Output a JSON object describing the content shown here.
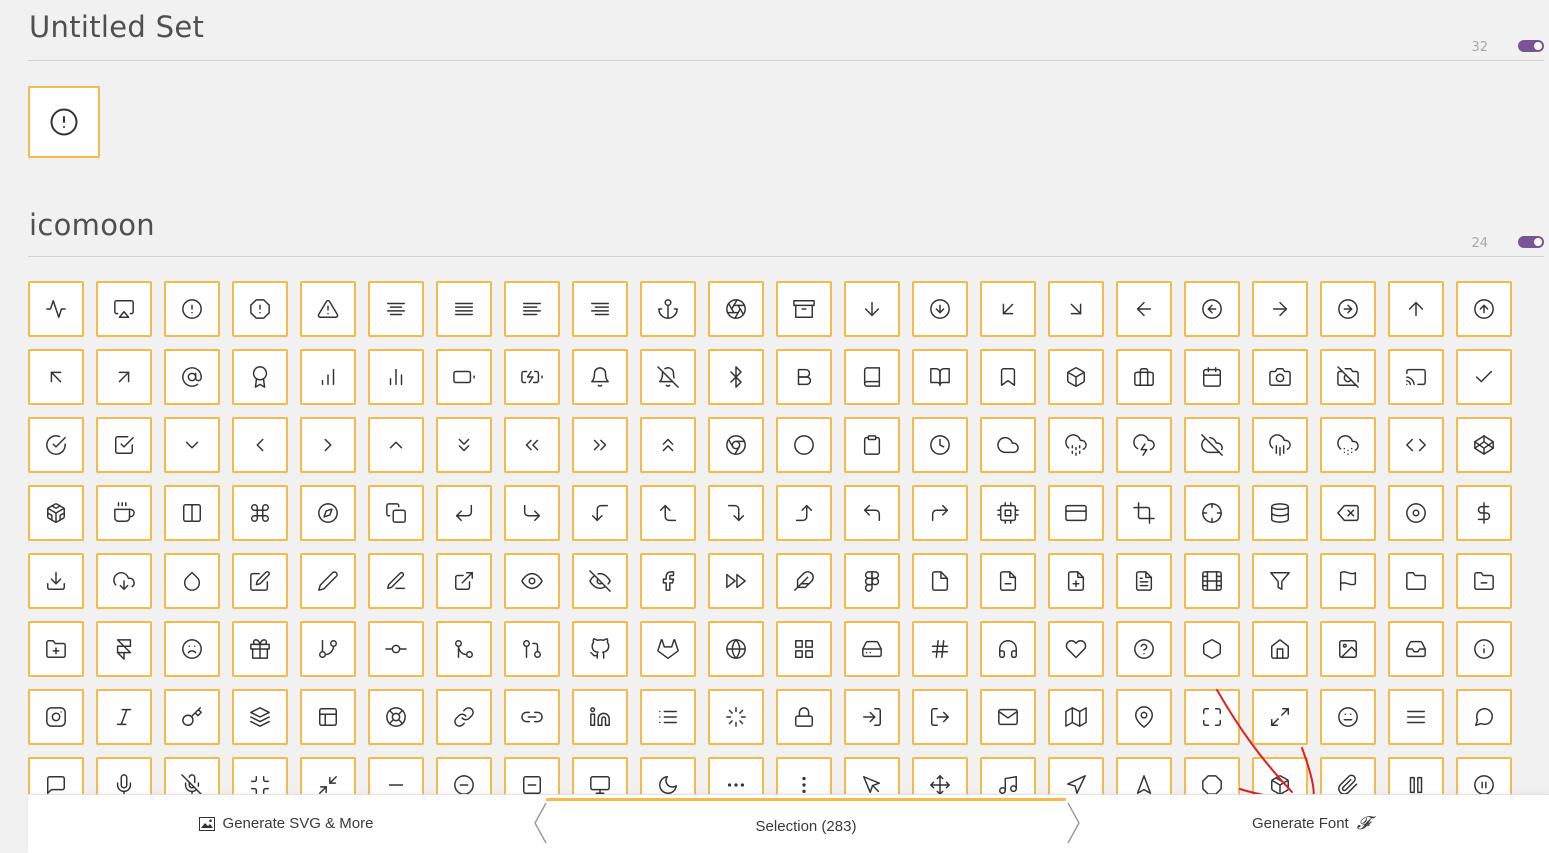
{
  "sets": [
    {
      "title": "Untitled Set",
      "count": "32",
      "enabled": true
    },
    {
      "title": "icomoon",
      "count": "24",
      "enabled": true
    }
  ],
  "untitled_icons": [
    "alert-circle"
  ],
  "icomoon_icons": [
    "activity",
    "airplay",
    "alert-circle",
    "alert-octagon",
    "alert-triangle",
    "align-center",
    "align-justify",
    "align-left",
    "align-right",
    "anchor",
    "aperture",
    "archive",
    "arrow-down",
    "arrow-down-circle",
    "arrow-down-left",
    "arrow-down-right",
    "arrow-left",
    "arrow-left-circle",
    "arrow-right",
    "arrow-right-circle",
    "arrow-up",
    "arrow-up-circle",
    "arrow-up-left",
    "arrow-up-right",
    "at-sign",
    "award",
    "bar-chart",
    "bar-chart-2",
    "battery",
    "battery-charging",
    "bell",
    "bell-off",
    "bluetooth",
    "bold",
    "book",
    "book-open",
    "bookmark",
    "box",
    "briefcase",
    "calendar",
    "camera",
    "camera-off",
    "cast",
    "check",
    "check-circle",
    "check-square",
    "chevron-down",
    "chevron-left",
    "chevron-right",
    "chevron-up",
    "chevrons-down",
    "chevrons-left",
    "chevrons-right",
    "chevrons-up",
    "chrome",
    "circle",
    "clipboard",
    "clock",
    "cloud",
    "cloud-drizzle",
    "cloud-lightning",
    "cloud-off",
    "cloud-rain",
    "cloud-snow",
    "code",
    "codepen",
    "codesandbox",
    "coffee",
    "columns",
    "command",
    "compass",
    "copy",
    "corner-down-left",
    "corner-down-right",
    "corner-left-down",
    "corner-left-up",
    "corner-right-down",
    "corner-right-up",
    "corner-up-left",
    "corner-up-right",
    "cpu",
    "credit-card",
    "crop",
    "crosshair",
    "database",
    "delete",
    "disc",
    "dollar-sign",
    "download",
    "download-cloud",
    "droplet",
    "edit",
    "edit-2",
    "edit-3",
    "external-link",
    "eye",
    "eye-off",
    "facebook",
    "fast-forward",
    "feather",
    "figma",
    "file",
    "file-minus",
    "file-plus",
    "file-text",
    "film",
    "filter",
    "flag",
    "folder",
    "folder-minus",
    "folder-plus",
    "framer",
    "frown",
    "gift",
    "git-branch",
    "git-commit",
    "git-merge",
    "git-pull-request",
    "github",
    "gitlab",
    "globe",
    "grid",
    "hard-drive",
    "hash",
    "headphones",
    "heart",
    "help-circle",
    "hexagon",
    "home",
    "image",
    "inbox",
    "info",
    "instagram",
    "italic",
    "key",
    "layers",
    "layout",
    "life-buoy",
    "link",
    "link-2",
    "linkedin",
    "list",
    "loader",
    "lock",
    "log-in",
    "log-out",
    "mail",
    "map",
    "map-pin",
    "maximize",
    "maximize-2",
    "meh",
    "menu",
    "message-circle",
    "message-square",
    "mic",
    "mic-off",
    "minimize",
    "minimize-2",
    "minus",
    "minus-circle",
    "minus-square",
    "monitor",
    "moon",
    "more-horizontal",
    "more-vertical",
    "mouse-pointer",
    "move",
    "music",
    "navigation",
    "navigation-2",
    "octagon",
    "package",
    "paperclip",
    "pause",
    "pause-circle"
  ],
  "bottom_bar": {
    "generate_svg_label": "Generate SVG & More",
    "selection_label": "Selection (283)",
    "generate_font_label": "Generate Font",
    "font_glyph": "𝓕"
  },
  "colors": {
    "tile_border": "#f6b94a",
    "toggle_on": "#7a5494",
    "annotation": "#e02020"
  }
}
